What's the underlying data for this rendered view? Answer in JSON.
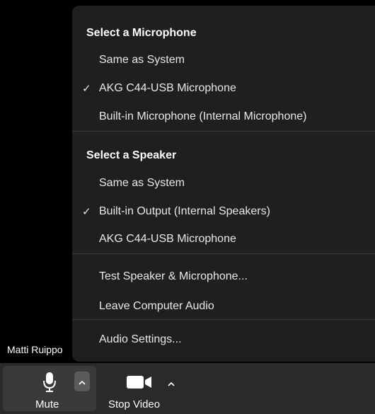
{
  "participant": {
    "name": "Matti Ruippo"
  },
  "menu": {
    "microphone_header": "Select a Microphone",
    "microphones": [
      {
        "label": "Same as System",
        "checked": false
      },
      {
        "label": "AKG C44-USB Microphone",
        "checked": true
      },
      {
        "label": "Built-in Microphone (Internal Microphone)",
        "checked": false
      }
    ],
    "speaker_header": "Select a Speaker",
    "speakers": [
      {
        "label": "Same as System",
        "checked": false
      },
      {
        "label": "Built-in Output (Internal Speakers)",
        "checked": true
      },
      {
        "label": "AKG C44-USB Microphone",
        "checked": false
      }
    ],
    "test_label": "Test Speaker & Microphone...",
    "leave_label": "Leave Computer Audio",
    "settings_label": "Audio Settings...",
    "check_glyph": "✓"
  },
  "toolbar": {
    "mute_label": "Mute",
    "stop_video_label": "Stop Video",
    "caret_glyph": "^"
  },
  "icons": {
    "mic": "microphone-icon",
    "video": "video-camera-icon",
    "caret": "caret-up-icon"
  },
  "colors": {
    "menu_bg": "#1f1f1f",
    "toolbar_bg": "#2a2a2a",
    "video_bg": "#000000"
  }
}
